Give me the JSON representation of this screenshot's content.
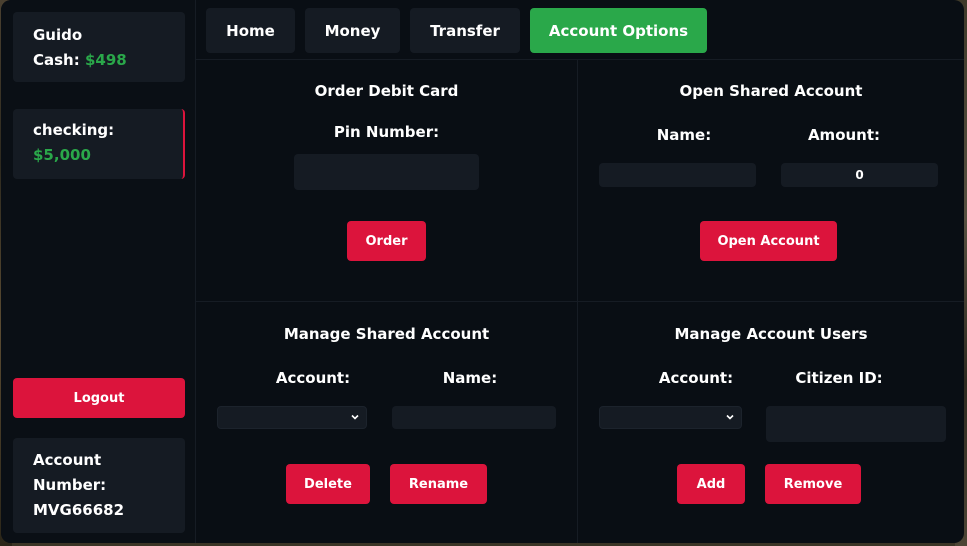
{
  "sidebar": {
    "user_name": "Guido",
    "cash_label": "Cash:",
    "cash_value": "$498",
    "checking_label": "checking:",
    "checking_value": "$5,000",
    "logout_label": "Logout",
    "account_number_label_1": "Account",
    "account_number_label_2": "Number:",
    "account_number_value": "MVG66682"
  },
  "tabs": [
    {
      "label": "Home"
    },
    {
      "label": "Money"
    },
    {
      "label": "Transfer"
    },
    {
      "label": "Account Options"
    }
  ],
  "order_card": {
    "title": "Order Debit Card",
    "pin_label": "Pin Number:",
    "button": "Order"
  },
  "open_shared": {
    "title": "Open Shared Account",
    "name_label": "Name:",
    "amount_label": "Amount:",
    "amount_value": "0",
    "button": "Open Account"
  },
  "manage_shared": {
    "title": "Manage Shared Account",
    "account_label": "Account:",
    "name_label": "Name:",
    "delete_button": "Delete",
    "rename_button": "Rename"
  },
  "manage_users": {
    "title": "Manage Account Users",
    "account_label": "Account:",
    "citizen_label": "Citizen ID:",
    "add_button": "Add",
    "remove_button": "Remove"
  },
  "colors": {
    "accent_green": "#2aa84a",
    "accent_red": "#dc143c",
    "panel": "#090e14",
    "card": "#151b23"
  }
}
